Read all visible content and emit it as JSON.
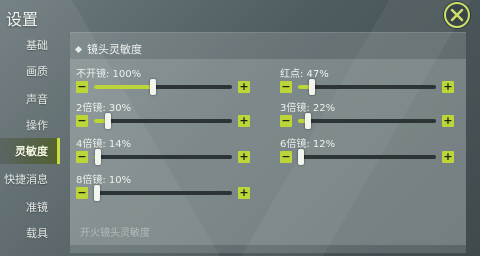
{
  "title": "设置",
  "sidebar": {
    "items": [
      {
        "label": "基础"
      },
      {
        "label": "画质"
      },
      {
        "label": "声音"
      },
      {
        "label": "操作"
      },
      {
        "label": "灵敏度",
        "active": true
      },
      {
        "label": "快捷消息"
      },
      {
        "label": "准镜"
      },
      {
        "label": "载具"
      }
    ]
  },
  "section": {
    "title": "镜头灵敏度"
  },
  "sliders": [
    {
      "label": "不开镜: 100%",
      "value": 0.43
    },
    {
      "label": "红点: 47%",
      "value": 0.1
    },
    {
      "label": "2倍镜: 30%",
      "value": 0.1
    },
    {
      "label": "3倍镜: 22%",
      "value": 0.07
    },
    {
      "label": "4倍镜: 14%",
      "value": 0.03
    },
    {
      "label": "6倍镜: 12%",
      "value": 0.02
    },
    {
      "label": "8倍镜: 10%",
      "value": 0.01
    }
  ],
  "next_section": {
    "title": "开火镜头灵敏度"
  },
  "colors": {
    "accent": "#bcd63a",
    "track": "#2c3436",
    "thumb": "#f2f4ee"
  },
  "icons": {
    "close": "close-icon",
    "minus": "minus-icon",
    "plus": "plus-icon"
  }
}
